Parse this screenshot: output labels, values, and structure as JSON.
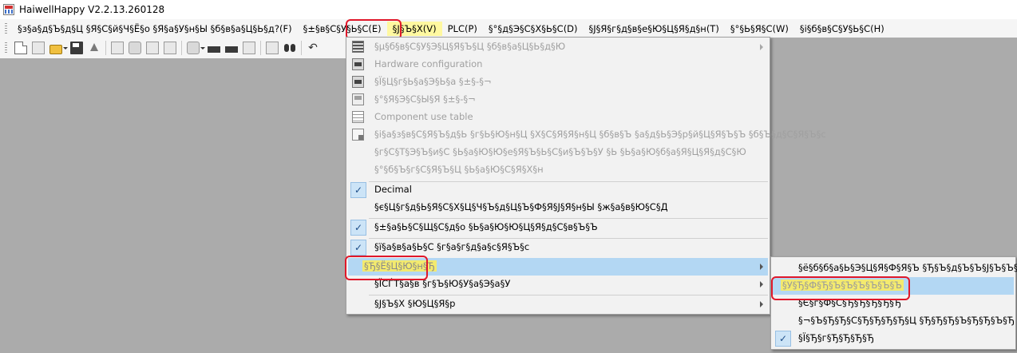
{
  "window": {
    "title": "HaiwellHappy V2.2.13.260128"
  },
  "menubar": {
    "items": [
      {
        "label": "§з§а§д§Ъ§д§Ц §Я§С§й§Ч§Ё§о §Я§а§У§н§Ы §б§в§а§Ц§Ь§д?(F)"
      },
      {
        "label": "§±§в§С§У§Ь§С(E)"
      },
      {
        "label": "§Ј§Ъ§Х(V)"
      },
      {
        "label": "PLC(P)"
      },
      {
        "label": "§°§д§Э§С§Х§Ь§С(D)"
      },
      {
        "label": "§Ј§Я§г§д§в§е§Ю§Ц§Я§д§н(T)"
      },
      {
        "label": "§°§Ь§Я§С(W)"
      },
      {
        "label": "§і§б§в§С§У§Ь§С(H)"
      }
    ]
  },
  "menu": {
    "items": [
      {
        "label": "§µ§б§в§С§У§Э§Ц§Я§Ъ§Ц §б§в§а§Ц§Ь§д§Ю",
        "disabled": true,
        "submenu": true,
        "icon": "config-icon"
      },
      {
        "label": "Hardware configuration",
        "disabled": true,
        "icon": "hardware-icon"
      },
      {
        "label": "§Ї§Ц§г§Ь§а§Э§Ь§а §±§-§¬",
        "disabled": true,
        "icon": "plc-icon"
      },
      {
        "label": "§°§Я§Э§С§Ы§Я §±§-§¬",
        "disabled": true,
        "icon": "online-icon"
      },
      {
        "label": "Component use table",
        "disabled": true,
        "icon": "table-icon"
      },
      {
        "label": "§і§а§з§в§С§Я§Ъ§д§Ь §г§Ь§Ю§н§Ц §Х§С§Я§Я§н§Ц §б§в§Ъ §а§д§Ь§Э§р§й§Ц§Я§Ъ§Ъ §б§Ъ§д§С§Я§Ъ§с",
        "disabled": true,
        "icon": "edit-icon"
      },
      {
        "label": "§г§С§Т§Э§Ъ§и§С §Ь§а§Ю§Ю§е§Я§Ъ§Ь§С§и§Ъ§Ъ§У §Ь §Ь§а§Ю§б§а§Я§Ц§Я§д§С§Ю",
        "disabled": true
      },
      {
        "label": "§°§б§Ъ§г§С§Я§Ъ§Ц §Ь§а§Ю§С§Я§Х§н",
        "disabled": true
      },
      {
        "label": "Decimal",
        "checked": true
      },
      {
        "label": "§є§Ц§г§д§Ь§Я§С§Х§Ц§Ч§Ъ§д§Ц§Ъ§Ф§Я§Ј§Я§н§Ы §ж§а§в§Ю§С§Д"
      },
      {
        "label": "§±§а§Ь§С§Щ§С§д§о §Ь§а§Ю§Ю§Ц§Я§д§С§в§Ъ§Ъ",
        "checked": true
      },
      {
        "label": "§ї§а§в§а§Ь§С §г§а§г§д§а§с§Я§Ъ§с",
        "checked": true
      },
      {
        "label": "§Ђ§Ё§Ц§Ю§н§Ђ",
        "submenu": true,
        "highlighted": true
      },
      {
        "label": "§ЇСЃТ§а§в §г§Ъ§Ю§У§а§Э§а§У",
        "submenu": true
      },
      {
        "label": "§Ј§Ъ§Х §Ю§Ц§Я§р",
        "submenu": true
      }
    ]
  },
  "submenu": {
    "items": [
      {
        "label": "§ё§б§б§а§Ь§Э§Ц§Я§Ф§Я§Ъ §Ђ§Ъ§д§Ъ§Ъ§Ј§Ъ§Ъ§Ъ"
      },
      {
        "label": "§У§Ђ§Ф§Ђ§Ъ§Ъ§Ъ§Ъ§Ъ§Ъ",
        "highlighted": true
      },
      {
        "label": "§Є§г§Ф§С§Ђ§Ђ§Ђ§Ђ§Ђ"
      },
      {
        "label": "§¬§Ъ§Ђ§Ђ§С§Ђ§Ђ§Ђ§Ђ§Ц §Ђ§Ђ§Ђ§Ъ§Ђ§Ђ§Ъ§Ђ"
      },
      {
        "label": "§Ї§Ђ§г§Ђ§Ђ§Ђ§Ђ",
        "checked": true
      }
    ]
  },
  "icons": [
    "new-file-icon",
    "new-project-icon",
    "open-folder-icon",
    "save-icon",
    "upload-icon",
    "print-icon",
    "print-preview-icon",
    "check-icon",
    "compile-icon",
    "ladder-icon",
    "download-icon",
    "upload-plc-icon",
    "monitor-icon",
    "edit-icon",
    "search-icon",
    "undo-icon"
  ],
  "colors": {
    "menu_background": "#f2f2f2",
    "hover": "#b3d7f3",
    "annotation_red": "#e0182a",
    "annotation_yellow": "#f3ea6f",
    "workspace": "#ababab"
  }
}
